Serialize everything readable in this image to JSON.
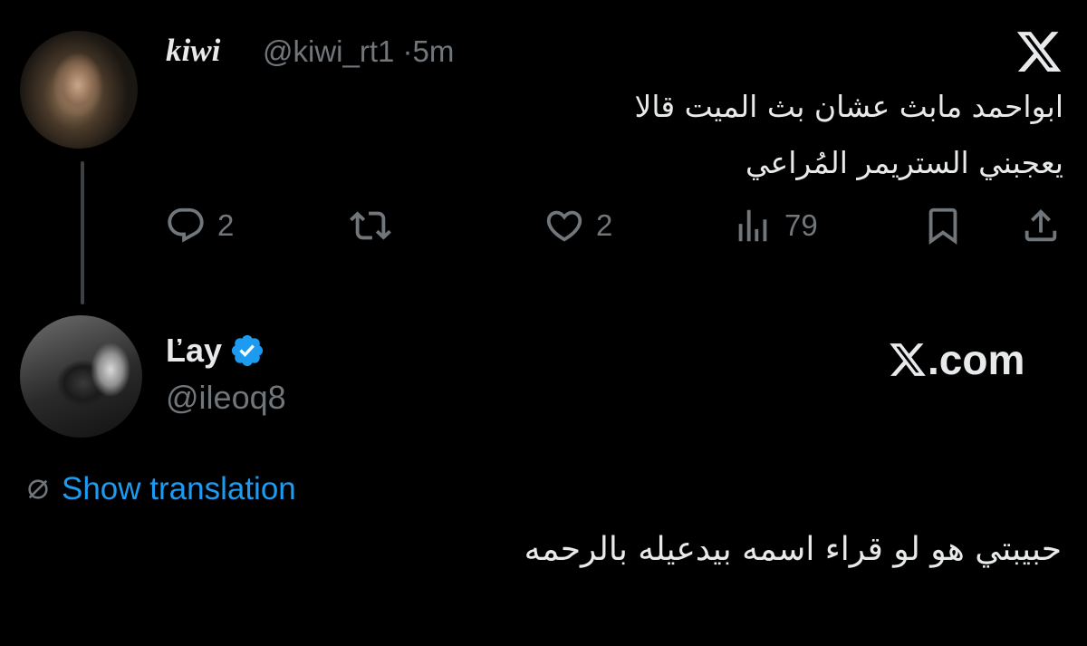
{
  "original_tweet": {
    "author_name": "kiwi",
    "handle": "@kiwi_rt1",
    "separator": "·",
    "time": "5m",
    "text_line_1": "ابواحمد مابث عشان بث الميت قالا",
    "text_line_2": "يعجبني الستريمر المُراعي",
    "actions": {
      "reply_count": "2",
      "retweet_count": "",
      "like_count": "2",
      "views_count": "79"
    }
  },
  "reply_tweet": {
    "author_name": "Ľay",
    "handle": "@ileoq8",
    "verified": true,
    "show_translation_label": "Show translation",
    "text": "حبيبتي هو لو قراء اسمه بيدعيله بالرحمه"
  },
  "branding": {
    "logo_name": "x-logo-icon",
    "site_label": ".com"
  },
  "colors": {
    "background": "#000000",
    "text_primary": "#e7e9ea",
    "text_secondary": "#71767b",
    "accent_blue": "#1d9bf0",
    "thread_line": "#3e4144"
  }
}
